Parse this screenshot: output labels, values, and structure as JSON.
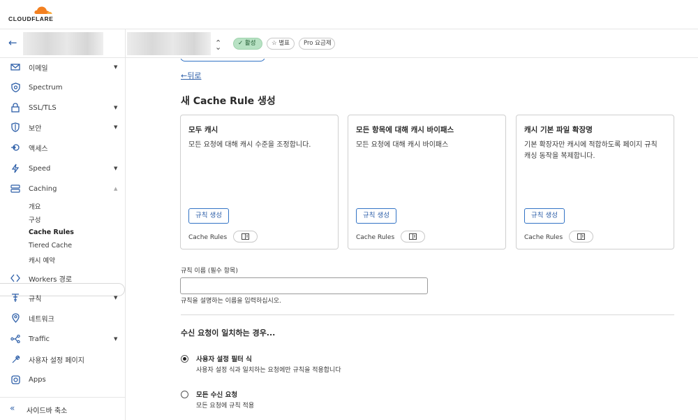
{
  "brand": {
    "name": "CLOUDFLARE",
    "accent": "#f38020"
  },
  "header": {
    "badges": {
      "active": "활성",
      "star": "별표",
      "plan": "Pro 요금제"
    }
  },
  "sidebar": {
    "items": [
      {
        "label": "이메일",
        "icon": "mail-icon",
        "caret": "▼"
      },
      {
        "label": "Spectrum",
        "icon": "shield-icon"
      },
      {
        "label": "SSL/TLS",
        "icon": "lock-icon",
        "caret": "▼"
      },
      {
        "label": "보안",
        "icon": "shield-outline-icon",
        "caret": "▼"
      },
      {
        "label": "액세스",
        "icon": "access-icon"
      },
      {
        "label": "Speed",
        "icon": "lightning-icon",
        "caret": "▼"
      },
      {
        "label": "Caching",
        "icon": "storage-icon",
        "caret": "▲"
      }
    ],
    "caching_sub": [
      "개요",
      "구성",
      "Cache Rules",
      "Tiered Cache",
      "캐시 예약"
    ],
    "items_after": [
      {
        "label": "Workers 경로",
        "icon": "workers-icon"
      },
      {
        "label": "규칙",
        "icon": "rules-icon",
        "caret": "▼"
      },
      {
        "label": "네트워크",
        "icon": "location-icon"
      },
      {
        "label": "Traffic",
        "icon": "traffic-icon",
        "caret": "▼"
      },
      {
        "label": "사용자 설정 페이지",
        "icon": "wrench-icon"
      },
      {
        "label": "Apps",
        "icon": "apps-icon"
      }
    ],
    "collapse": {
      "icon": "double-chevron-left-icon",
      "label": "사이드바 축소"
    }
  },
  "main": {
    "back_link": "←뒤로",
    "title": "새 Cache Rule 생성",
    "cards": [
      {
        "title": "모두 캐시",
        "desc": "모든 요청에 대해 캐시 수준을 조정합니다.",
        "button": "규칙 생성",
        "foot": "Cache Rules"
      },
      {
        "title": "모든 항목에 대해 캐시 바이패스",
        "desc": "모든 요청에 대해 캐시 바이패스",
        "button": "규칙 생성",
        "foot": "Cache Rules"
      },
      {
        "title": "캐시 기본 파일 확장명",
        "desc": "기본 확장자만 캐시에 적합하도록 페이지 규칙 캐싱 동작을 복제합니다.",
        "button": "규칙 생성",
        "foot": "Cache Rules"
      }
    ],
    "rule_name": {
      "label": "규칙 이름 (필수 항목)",
      "value": "",
      "help": "규칙을 설명하는 이름을 입력하십시오."
    },
    "match_section": {
      "title": "수신 요청이 일치하는 경우...",
      "options": [
        {
          "title": "사용자 설정 필터 식",
          "desc": "사용자 설정 식과 일치하는 요청에만 규칙을 적용합니다",
          "selected": true
        },
        {
          "title": "모든 수신 요청",
          "desc": "모든 요청에 규칙 적용",
          "selected": false
        }
      ]
    }
  }
}
